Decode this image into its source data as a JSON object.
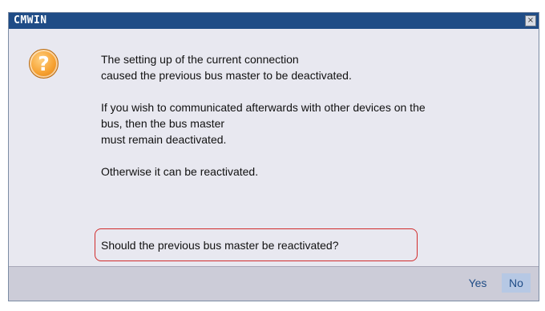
{
  "window": {
    "title": "CMWIN",
    "close_glyph": "×"
  },
  "dialog": {
    "icon": "question-icon",
    "icon_glyph": "?",
    "paragraphs": [
      [
        "The setting up of the current connection",
        "caused the previous bus master to be deactivated."
      ],
      [
        "If you wish to communicated afterwards with other devices on the",
        "bus, then the bus master",
        "must remain deactivated."
      ],
      [
        "Otherwise it can be reactivated."
      ]
    ],
    "question": "Should the previous bus master be reactivated?"
  },
  "buttons": {
    "yes": "Yes",
    "no": "No"
  },
  "colors": {
    "titlebar": "#1f4c86",
    "highlight_border": "#d12c2c",
    "icon_orange": "#f6a131",
    "selected_button": "#b6c8e4"
  }
}
